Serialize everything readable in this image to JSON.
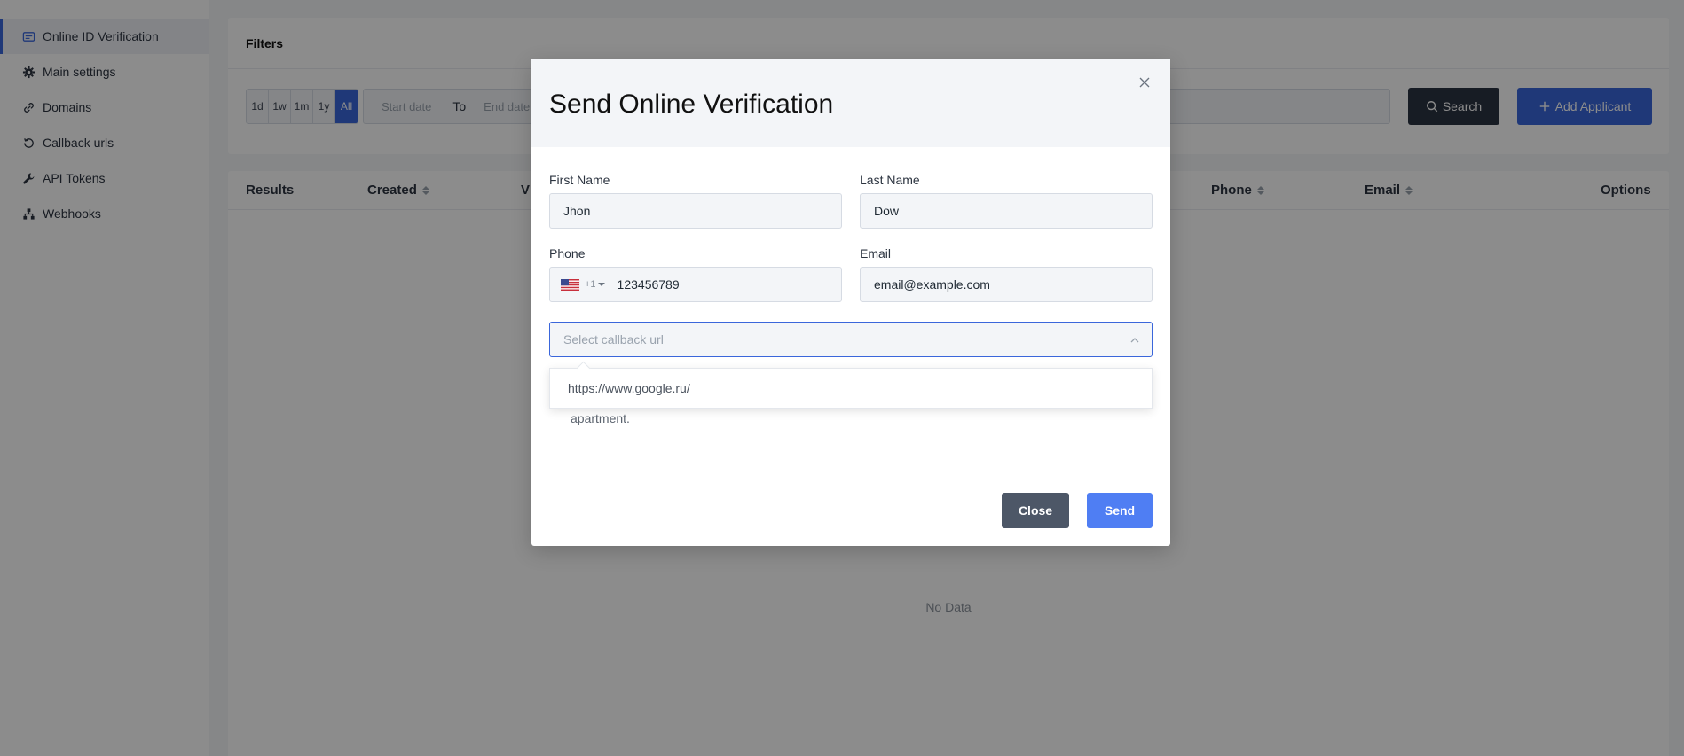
{
  "sidebar": {
    "items": [
      {
        "label": "Online ID Verification",
        "icon": "id-card-icon",
        "active": true
      },
      {
        "label": "Main settings",
        "icon": "gear-icon"
      },
      {
        "label": "Domains",
        "icon": "link-icon"
      },
      {
        "label": "Callback urls",
        "icon": "history-icon"
      },
      {
        "label": "API Tokens",
        "icon": "wrench-icon"
      },
      {
        "label": "Webhooks",
        "icon": "sitemap-icon"
      }
    ]
  },
  "filters": {
    "title": "Filters",
    "ranges": [
      "1d",
      "1w",
      "1m",
      "1y",
      "All"
    ],
    "active_range": "All",
    "start_placeholder": "Start date",
    "to_label": "To",
    "end_placeholder": "End date",
    "search_label": "Search",
    "add_label": "Add Applicant"
  },
  "results": {
    "columns": [
      "Results",
      "Created",
      "V",
      "Phone",
      "Email",
      "Options"
    ],
    "empty_text": "No Data"
  },
  "modal": {
    "title": "Send Online Verification",
    "first_name": {
      "label": "First Name",
      "value": "Jhon"
    },
    "last_name": {
      "label": "Last Name",
      "value": "Dow"
    },
    "phone": {
      "label": "Phone",
      "country_code": "+1",
      "value": "123456789"
    },
    "email": {
      "label": "Email",
      "value": "email@example.com"
    },
    "callback": {
      "placeholder": "Select callback url",
      "options": [
        "https://www.google.ru/"
      ]
    },
    "hint_text": "apartment.",
    "close_label": "Close",
    "send_label": "Send"
  },
  "colors": {
    "accent": "#3a66db",
    "dark_button": "#2b3342",
    "send_button": "#4f7ef3",
    "close_button": "#4d5767"
  }
}
